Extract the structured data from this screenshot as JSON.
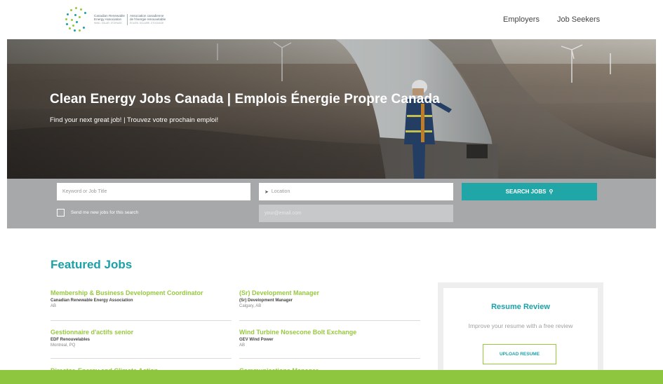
{
  "header": {
    "logo": {
      "en_line1": "Canadian Renewable",
      "en_line2": "Energy Association",
      "en_line3": "WIND. SOLAR. STORAGE.",
      "fr_line1": "Association canadienne",
      "fr_line2": "de l'énergie renouvelable",
      "fr_line3": "ÉOLIEN. SOLAIRE. STOCKAGE."
    },
    "nav": {
      "employers": "Employers",
      "job_seekers": "Job Seekers"
    }
  },
  "hero": {
    "title": "Clean Energy Jobs Canada | Emplois Énergie Propre Canada",
    "subtitle": "Find your next great job! | Trouvez votre prochain emploi!"
  },
  "search": {
    "keyword_placeholder": "Keyword or Job Title",
    "location_placeholder": "Location",
    "location_icon": "location-arrow-icon",
    "button_label": "SEARCH JOBS",
    "button_icon": "magnifier-icon",
    "alert_label": "Send me new jobs for this search",
    "email_placeholder": "your@email.com"
  },
  "featured": {
    "title": "Featured Jobs",
    "jobs": [
      {
        "title": "Membership & Business Development Coordinator",
        "company": "Canadian Renewable Energy Association",
        "location": "AB"
      },
      {
        "title": "(Sr) Development Manager",
        "company": "(Sr) Development Manager",
        "location": "Calgary, AB"
      },
      {
        "title": "Gestionnaire d'actifs senior",
        "company": "EDF Renouvelables",
        "location": "Montreal, PQ"
      },
      {
        "title": "Wind Turbine Nosecone Bolt Exchange",
        "company": "GEV Wind Power",
        "location": "AB"
      },
      {
        "title": "Director, Energy and Climate Action",
        "company": "",
        "location": ""
      },
      {
        "title": "Communications Manager",
        "company": "",
        "location": ""
      }
    ]
  },
  "resume": {
    "title": "Resume Review",
    "text": "Improve your resume with a free review",
    "button_label": "UPLOAD RESUME"
  },
  "colors": {
    "teal": "#1aa1a8",
    "button_teal": "#21a6a7",
    "green": "#96c93d",
    "bar_green": "#8fc640",
    "search_band": "#a6a8a9"
  }
}
